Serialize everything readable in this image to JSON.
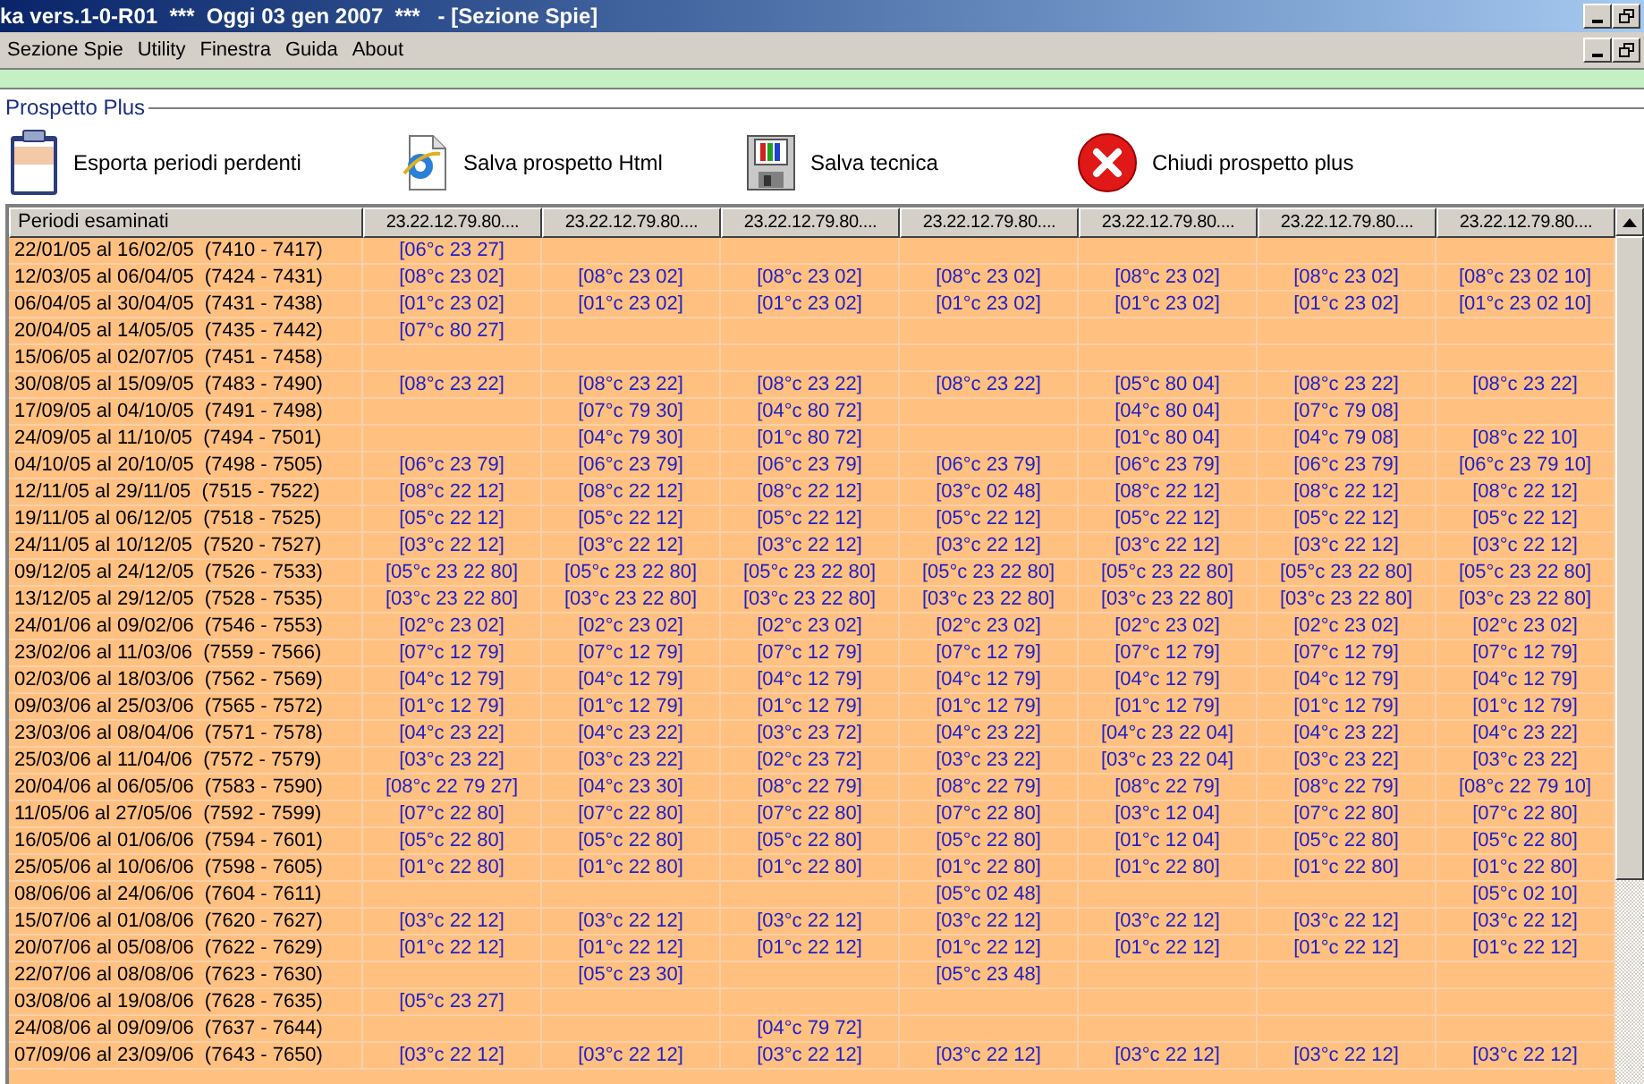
{
  "window": {
    "title": "ka vers.1-0-R01  ***  Oggi 03 gen 2007  ***   - [Sezione Spie]"
  },
  "menu": [
    "Sezione Spie",
    "Utility",
    "Finestra",
    "Guida",
    "About"
  ],
  "group": {
    "title": "Prospetto Plus"
  },
  "toolbar": [
    {
      "kind": "clipboard",
      "label": "Esporta periodi perdenti"
    },
    {
      "kind": "html",
      "label": "Salva prospetto Html"
    },
    {
      "kind": "floppy",
      "label": "Salva tecnica"
    },
    {
      "kind": "close",
      "label": "Chiudi prospetto plus"
    }
  ],
  "table": {
    "columns": [
      "Periodi esaminati",
      "23.22.12.79.80....",
      "23.22.12.79.80....",
      "23.22.12.79.80....",
      "23.22.12.79.80....",
      "23.22.12.79.80....",
      "23.22.12.79.80....",
      "23.22.12.79.80...."
    ],
    "rows": [
      [
        "22/01/05 al 16/02/05  (7410 - 7417)",
        "[06°c 23 27]",
        "",
        "",
        "",
        "",
        "",
        ""
      ],
      [
        "12/03/05 al 06/04/05  (7424 - 7431)",
        "[08°c 23 02]",
        "[08°c 23 02]",
        "[08°c 23 02]",
        "[08°c 23 02]",
        "[08°c 23 02]",
        "[08°c 23 02]",
        "[08°c 23 02 10]"
      ],
      [
        "06/04/05 al 30/04/05  (7431 - 7438)",
        "[01°c 23 02]",
        "[01°c 23 02]",
        "[01°c 23 02]",
        "[01°c 23 02]",
        "[01°c 23 02]",
        "[01°c 23 02]",
        "[01°c 23 02 10]"
      ],
      [
        "20/04/05 al 14/05/05  (7435 - 7442)",
        "[07°c 80 27]",
        "",
        "",
        "",
        "",
        "",
        ""
      ],
      [
        "15/06/05 al 02/07/05  (7451 - 7458)",
        "",
        "",
        "",
        "",
        "",
        "",
        ""
      ],
      [
        "30/08/05 al 15/09/05  (7483 - 7490)",
        "[08°c 23 22]",
        "[08°c 23 22]",
        "[08°c 23 22]",
        "[08°c 23 22]",
        "[05°c 80 04]",
        "[08°c 23 22]",
        "[08°c 23 22]"
      ],
      [
        "17/09/05 al 04/10/05  (7491 - 7498)",
        "",
        "[07°c 79 30]",
        "[04°c 80 72]",
        "",
        "[04°c 80 04]",
        "[07°c 79 08]",
        ""
      ],
      [
        "24/09/05 al 11/10/05  (7494 - 7501)",
        "",
        "[04°c 79 30]",
        "[01°c 80 72]",
        "",
        "[01°c 80 04]",
        "[04°c 79 08]",
        "[08°c 22 10]"
      ],
      [
        "04/10/05 al 20/10/05  (7498 - 7505)",
        "[06°c 23 79]",
        "[06°c 23 79]",
        "[06°c 23 79]",
        "[06°c 23 79]",
        "[06°c 23 79]",
        "[06°c 23 79]",
        "[06°c 23 79 10]"
      ],
      [
        "12/11/05 al 29/11/05  (7515 - 7522)",
        "[08°c 22 12]",
        "[08°c 22 12]",
        "[08°c 22 12]",
        "[03°c 02 48]",
        "[08°c 22 12]",
        "[08°c 22 12]",
        "[08°c 22 12]"
      ],
      [
        "19/11/05 al 06/12/05  (7518 - 7525)",
        "[05°c 22 12]",
        "[05°c 22 12]",
        "[05°c 22 12]",
        "[05°c 22 12]",
        "[05°c 22 12]",
        "[05°c 22 12]",
        "[05°c 22 12]"
      ],
      [
        "24/11/05 al 10/12/05  (7520 - 7527)",
        "[03°c 22 12]",
        "[03°c 22 12]",
        "[03°c 22 12]",
        "[03°c 22 12]",
        "[03°c 22 12]",
        "[03°c 22 12]",
        "[03°c 22 12]"
      ],
      [
        "09/12/05 al 24/12/05  (7526 - 7533)",
        "[05°c 23 22 80]",
        "[05°c 23 22 80]",
        "[05°c 23 22 80]",
        "[05°c 23 22 80]",
        "[05°c 23 22 80]",
        "[05°c 23 22 80]",
        "[05°c 23 22 80]"
      ],
      [
        "13/12/05 al 29/12/05  (7528 - 7535)",
        "[03°c 23 22 80]",
        "[03°c 23 22 80]",
        "[03°c 23 22 80]",
        "[03°c 23 22 80]",
        "[03°c 23 22 80]",
        "[03°c 23 22 80]",
        "[03°c 23 22 80]"
      ],
      [
        "24/01/06 al 09/02/06  (7546 - 7553)",
        "[02°c 23 02]",
        "[02°c 23 02]",
        "[02°c 23 02]",
        "[02°c 23 02]",
        "[02°c 23 02]",
        "[02°c 23 02]",
        "[02°c 23 02]"
      ],
      [
        "23/02/06 al 11/03/06  (7559 - 7566)",
        "[07°c 12 79]",
        "[07°c 12 79]",
        "[07°c 12 79]",
        "[07°c 12 79]",
        "[07°c 12 79]",
        "[07°c 12 79]",
        "[07°c 12 79]"
      ],
      [
        "02/03/06 al 18/03/06  (7562 - 7569)",
        "[04°c 12 79]",
        "[04°c 12 79]",
        "[04°c 12 79]",
        "[04°c 12 79]",
        "[04°c 12 79]",
        "[04°c 12 79]",
        "[04°c 12 79]"
      ],
      [
        "09/03/06 al 25/03/06  (7565 - 7572)",
        "[01°c 12 79]",
        "[01°c 12 79]",
        "[01°c 12 79]",
        "[01°c 12 79]",
        "[01°c 12 79]",
        "[01°c 12 79]",
        "[01°c 12 79]"
      ],
      [
        "23/03/06 al 08/04/06  (7571 - 7578)",
        "[04°c 23 22]",
        "[04°c 23 22]",
        "[03°c 23 72]",
        "[04°c 23 22]",
        "[04°c 23 22 04]",
        "[04°c 23 22]",
        "[04°c 23 22]"
      ],
      [
        "25/03/06 al 11/04/06  (7572 - 7579)",
        "[03°c 23 22]",
        "[03°c 23 22]",
        "[02°c 23 72]",
        "[03°c 23 22]",
        "[03°c 23 22 04]",
        "[03°c 23 22]",
        "[03°c 23 22]"
      ],
      [
        "20/04/06 al 06/05/06  (7583 - 7590)",
        "[08°c 22 79 27]",
        "[04°c 23 30]",
        "[08°c 22 79]",
        "[08°c 22 79]",
        "[08°c 22 79]",
        "[08°c 22 79]",
        "[08°c 22 79 10]"
      ],
      [
        "11/05/06 al 27/05/06  (7592 - 7599)",
        "[07°c 22 80]",
        "[07°c 22 80]",
        "[07°c 22 80]",
        "[07°c 22 80]",
        "[03°c 12 04]",
        "[07°c 22 80]",
        "[07°c 22 80]"
      ],
      [
        "16/05/06 al 01/06/06  (7594 - 7601)",
        "[05°c 22 80]",
        "[05°c 22 80]",
        "[05°c 22 80]",
        "[05°c 22 80]",
        "[01°c 12 04]",
        "[05°c 22 80]",
        "[05°c 22 80]"
      ],
      [
        "25/05/06 al 10/06/06  (7598 - 7605)",
        "[01°c 22 80]",
        "[01°c 22 80]",
        "[01°c 22 80]",
        "[01°c 22 80]",
        "[01°c 22 80]",
        "[01°c 22 80]",
        "[01°c 22 80]"
      ],
      [
        "08/06/06 al 24/06/06  (7604 - 7611)",
        "",
        "",
        "",
        "[05°c 02 48]",
        "",
        "",
        "[05°c 02 10]"
      ],
      [
        "15/07/06 al 01/08/06  (7620 - 7627)",
        "[03°c 22 12]",
        "[03°c 22 12]",
        "[03°c 22 12]",
        "[03°c 22 12]",
        "[03°c 22 12]",
        "[03°c 22 12]",
        "[03°c 22 12]"
      ],
      [
        "20/07/06 al 05/08/06  (7622 - 7629)",
        "[01°c 22 12]",
        "[01°c 22 12]",
        "[01°c 22 12]",
        "[01°c 22 12]",
        "[01°c 22 12]",
        "[01°c 22 12]",
        "[01°c 22 12]"
      ],
      [
        "22/07/06 al 08/08/06  (7623 - 7630)",
        "",
        "[05°c 23 30]",
        "",
        "[05°c 23 48]",
        "",
        "",
        ""
      ],
      [
        "03/08/06 al 19/08/06  (7628 - 7635)",
        "[05°c 23 27]",
        "",
        "",
        "",
        "",
        "",
        ""
      ],
      [
        "24/08/06 al 09/09/06  (7637 - 7644)",
        "",
        "",
        "[04°c 79 72]",
        "",
        "",
        "",
        ""
      ],
      [
        "07/09/06 al 23/09/06  (7643 - 7650)",
        "[03°c 22 12]",
        "[03°c 22 12]",
        "[03°c 22 12]",
        "[03°c 22 12]",
        "[03°c 22 12]",
        "[03°c 22 12]",
        "[03°c 22 12]"
      ]
    ]
  }
}
